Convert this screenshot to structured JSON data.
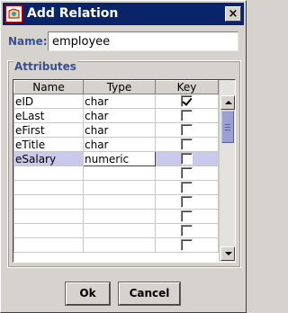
{
  "window": {
    "title": "Add Relation",
    "close_label": "×"
  },
  "name": {
    "label": "Name:",
    "value": "employee"
  },
  "attributes": {
    "legend": "Attributes",
    "columns": [
      "Name",
      "Type",
      "Key"
    ],
    "rows": [
      {
        "name": "eID",
        "type": "char",
        "key": true
      },
      {
        "name": "eLast",
        "type": "char",
        "key": false
      },
      {
        "name": "eFirst",
        "type": "char",
        "key": false
      },
      {
        "name": "eTitle",
        "type": "char",
        "key": false
      },
      {
        "name": "eSalary",
        "type": "numeric",
        "key": false,
        "selected": true,
        "editing_type": true
      },
      {
        "name": "",
        "type": "",
        "key": false
      },
      {
        "name": "",
        "type": "",
        "key": false
      },
      {
        "name": "",
        "type": "",
        "key": false
      },
      {
        "name": "",
        "type": "",
        "key": false
      },
      {
        "name": "",
        "type": "",
        "key": false
      },
      {
        "name": "",
        "type": "",
        "key": false
      }
    ]
  },
  "buttons": {
    "ok": "Ok",
    "cancel": "Cancel"
  },
  "colors": {
    "title_bar": "#0a246a",
    "label_text": "#3b4f8f",
    "selection": "#c9c9ee",
    "scroll_thumb": "#9b9fd2"
  }
}
